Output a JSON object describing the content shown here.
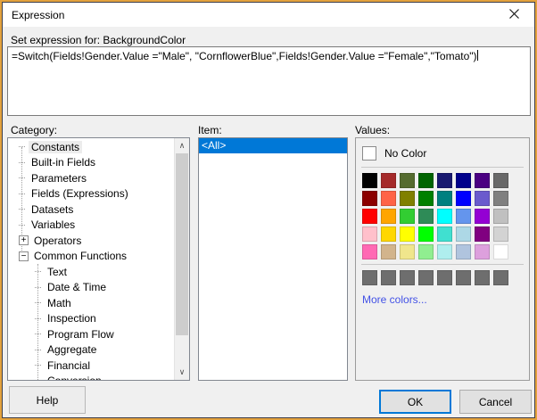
{
  "dialog": {
    "title": "Expression"
  },
  "icons": {
    "close": "close-x",
    "scroll_up": "∧",
    "scroll_down": "∨"
  },
  "expression": {
    "label": "Set expression for: BackgroundColor",
    "value": "=Switch(Fields!Gender.Value =\"Male\", \"CornflowerBlue\",Fields!Gender.Value =\"Female\",\"Tomato\")"
  },
  "category": {
    "label": "Category:",
    "items": [
      {
        "label": "Constants",
        "level": 0,
        "expander": null,
        "selected": true
      },
      {
        "label": "Built-in Fields",
        "level": 0,
        "expander": null,
        "selected": false
      },
      {
        "label": "Parameters",
        "level": 0,
        "expander": null,
        "selected": false
      },
      {
        "label": "Fields (Expressions)",
        "level": 0,
        "expander": null,
        "selected": false
      },
      {
        "label": "Datasets",
        "level": 0,
        "expander": null,
        "selected": false
      },
      {
        "label": "Variables",
        "level": 0,
        "expander": null,
        "selected": false
      },
      {
        "label": "Operators",
        "level": 0,
        "expander": "+",
        "selected": false
      },
      {
        "label": "Common Functions",
        "level": 0,
        "expander": "−",
        "selected": false
      },
      {
        "label": "Text",
        "level": 1,
        "expander": null,
        "selected": false
      },
      {
        "label": "Date & Time",
        "level": 1,
        "expander": null,
        "selected": false
      },
      {
        "label": "Math",
        "level": 1,
        "expander": null,
        "selected": false
      },
      {
        "label": "Inspection",
        "level": 1,
        "expander": null,
        "selected": false
      },
      {
        "label": "Program Flow",
        "level": 1,
        "expander": null,
        "selected": false
      },
      {
        "label": "Aggregate",
        "level": 1,
        "expander": null,
        "selected": false
      },
      {
        "label": "Financial",
        "level": 1,
        "expander": null,
        "selected": false
      },
      {
        "label": "Conversion",
        "level": 1,
        "expander": null,
        "selected": false
      }
    ],
    "scrollbar": {
      "thumb_position": "top",
      "visible": true
    }
  },
  "item": {
    "label": "Item:",
    "items": [
      {
        "label": "<All>",
        "selected": true
      }
    ]
  },
  "values": {
    "label": "Values:",
    "no_color_label": "No Color",
    "palette": [
      [
        "#000000",
        "#A52A2A",
        "#556B2F",
        "#006400",
        "#191970",
        "#00008B",
        "#4B0082",
        "#696969"
      ],
      [
        "#8B0000",
        "#FF6347",
        "#808000",
        "#008000",
        "#008080",
        "#0000FF",
        "#6A5ACD",
        "#808080"
      ],
      [
        "#FF0000",
        "#FFA500",
        "#32CD32",
        "#2E8B57",
        "#00FFFF",
        "#6495ED",
        "#9400D3",
        "#C0C0C0"
      ],
      [
        "#FFC0CB",
        "#FFD700",
        "#FFFF00",
        "#00FF00",
        "#40E0D0",
        "#ADD8E6",
        "#800080",
        "#D3D3D3"
      ],
      [
        "#FF69B4",
        "#D2B48C",
        "#F0E68C",
        "#90EE90",
        "#AFEEEE",
        "#B0C4DE",
        "#DDA0DD",
        "#FFFFFF"
      ]
    ],
    "custom_colors": [
      "#6E6E6E",
      "#6E6E6E",
      "#6E6E6E",
      "#6E6E6E",
      "#6E6E6E",
      "#6E6E6E",
      "#6E6E6E",
      "#6E6E6E"
    ],
    "more_colors_label": "More colors...",
    "link_color": "#4251E6"
  },
  "buttons": {
    "help": "Help",
    "ok": "OK",
    "cancel": "Cancel"
  },
  "colors": {
    "selection": "#0078D7",
    "accent_focus_border": "#0078D7",
    "dialog_background": "#F0F0F0",
    "titlebar_background": "#FFFFFF",
    "frame_outer": "#E3A23D",
    "frame_inner": "#3E3E4A",
    "scrollbar_thumb": "#CDCDCD"
  }
}
